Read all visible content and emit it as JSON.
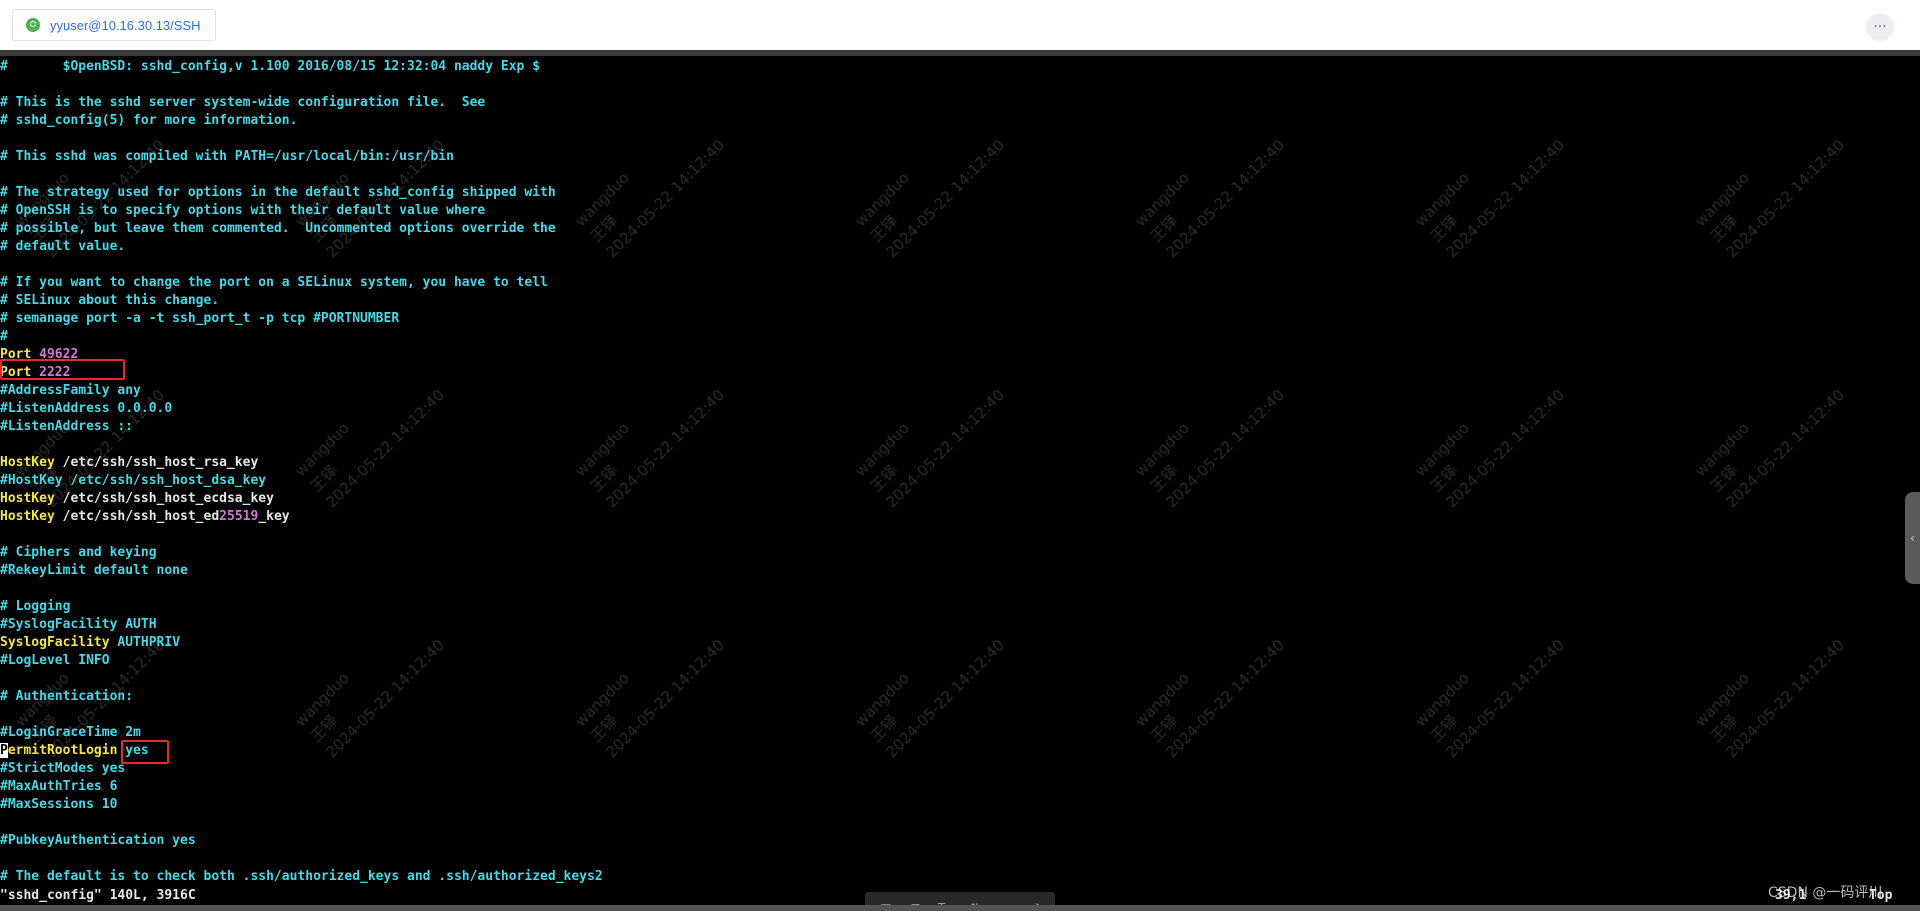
{
  "tab": {
    "title": "yyuser@10.16.30.13/SSH",
    "icon": "ssh-connection-icon",
    "icon_color": "#4caf50"
  },
  "more_button": {
    "label": "···"
  },
  "terminal": {
    "lines": [
      [
        {
          "t": "#       $OpenBSD: sshd_config,v 1.100 2016/08/15 12:32:04 naddy Exp $",
          "c": "cyan"
        }
      ],
      [],
      [
        {
          "t": "# This is the sshd server system-wide configuration file.  See",
          "c": "cyan"
        }
      ],
      [
        {
          "t": "# sshd_config(5) for more information.",
          "c": "cyan"
        }
      ],
      [],
      [
        {
          "t": "# This sshd was compiled with PATH=/usr/local/bin:/usr/bin",
          "c": "cyan"
        }
      ],
      [],
      [
        {
          "t": "# The strategy used for options in the default sshd_config shipped with",
          "c": "cyan"
        }
      ],
      [
        {
          "t": "# OpenSSH is to specify options with their default value where",
          "c": "cyan"
        }
      ],
      [
        {
          "t": "# possible, but leave them commented.  Uncommented options override the",
          "c": "cyan"
        }
      ],
      [
        {
          "t": "# default value.",
          "c": "cyan"
        }
      ],
      [],
      [
        {
          "t": "# If you want to change the port on a SELinux system, you have to tell",
          "c": "cyan"
        }
      ],
      [
        {
          "t": "# SELinux about this change.",
          "c": "cyan"
        }
      ],
      [
        {
          "t": "# semanage port -a -t ssh_port_t -p tcp #PORTNUMBER",
          "c": "cyan"
        }
      ],
      [
        {
          "t": "#",
          "c": "cyan"
        }
      ],
      [
        {
          "t": "Port",
          "c": "yellow"
        },
        {
          "t": " ",
          "c": "plain"
        },
        {
          "t": "49622",
          "c": "magenta"
        }
      ],
      [
        {
          "t": "Port",
          "c": "yellow"
        },
        {
          "t": " ",
          "c": "plain"
        },
        {
          "t": "2222",
          "c": "magenta"
        }
      ],
      [
        {
          "t": "#AddressFamily any",
          "c": "cyan"
        }
      ],
      [
        {
          "t": "#ListenAddress 0.0.0.0",
          "c": "cyan"
        }
      ],
      [
        {
          "t": "#ListenAddress ::",
          "c": "cyan"
        }
      ],
      [],
      [
        {
          "t": "HostKey",
          "c": "yellow"
        },
        {
          "t": " /etc/ssh/ssh_host_rsa_key",
          "c": "white"
        }
      ],
      [
        {
          "t": "#HostKey /etc/ssh/ssh_host_dsa_key",
          "c": "cyan"
        }
      ],
      [
        {
          "t": "HostKey",
          "c": "yellow"
        },
        {
          "t": " /etc/ssh/ssh_host_ecdsa_key",
          "c": "white"
        }
      ],
      [
        {
          "t": "HostKey",
          "c": "yellow"
        },
        {
          "t": " /etc/ssh/ssh_host_ed",
          "c": "white"
        },
        {
          "t": "25519",
          "c": "magenta"
        },
        {
          "t": "_key",
          "c": "white"
        }
      ],
      [],
      [
        {
          "t": "# Ciphers and keying",
          "c": "cyan"
        }
      ],
      [
        {
          "t": "#RekeyLimit default none",
          "c": "cyan"
        }
      ],
      [],
      [
        {
          "t": "# Logging",
          "c": "cyan"
        }
      ],
      [
        {
          "t": "#SyslogFacility AUTH",
          "c": "cyan"
        }
      ],
      [
        {
          "t": "SyslogFacility",
          "c": "yellow"
        },
        {
          "t": " AUTHPRIV",
          "c": "cyan"
        }
      ],
      [
        {
          "t": "#LogLevel INFO",
          "c": "cyan"
        }
      ],
      [],
      [
        {
          "t": "# Authentication:",
          "c": "cyan"
        }
      ],
      [],
      [
        {
          "t": "#LoginGraceTime 2m",
          "c": "cyan"
        }
      ],
      [
        {
          "t": "P",
          "c": "cursor"
        },
        {
          "t": "ermitRootLogin",
          "c": "yellow"
        },
        {
          "t": " yes",
          "c": "cyan"
        }
      ],
      [
        {
          "t": "#StrictModes yes",
          "c": "cyan"
        }
      ],
      [
        {
          "t": "#MaxAuthTries 6",
          "c": "cyan"
        }
      ],
      [
        {
          "t": "#MaxSessions 10",
          "c": "cyan"
        }
      ],
      [],
      [
        {
          "t": "#PubkeyAuthentication yes",
          "c": "cyan"
        }
      ],
      [],
      [
        {
          "t": "# The default is to check both .ssh/authorized_keys and .ssh/authorized_keys2",
          "c": "cyan"
        }
      ]
    ],
    "status_line": "\"sshd_config\" 140L, 3916C",
    "cursor_position": "39,1",
    "scroll_position": "Top"
  },
  "overlay_credit": "CSDN @一码评川",
  "watermark": {
    "name": "wangduo",
    "name_cn": "王铎",
    "timestamp": "2024-05-22 14:12:40"
  },
  "floating_toolbar": {
    "icons": [
      "table-icon",
      "grid-icon",
      "text-size-icon",
      "transfer-icon",
      "link-icon",
      "fullscreen-icon"
    ]
  },
  "side_handle": {
    "icon": "chevron-left-icon"
  },
  "colors": {
    "cyan": "#47d7e5",
    "yellow": "#f4e64a",
    "magenta": "#d478d4",
    "highlight": "#e32a2a",
    "tab_link": "#2f6fd6"
  }
}
